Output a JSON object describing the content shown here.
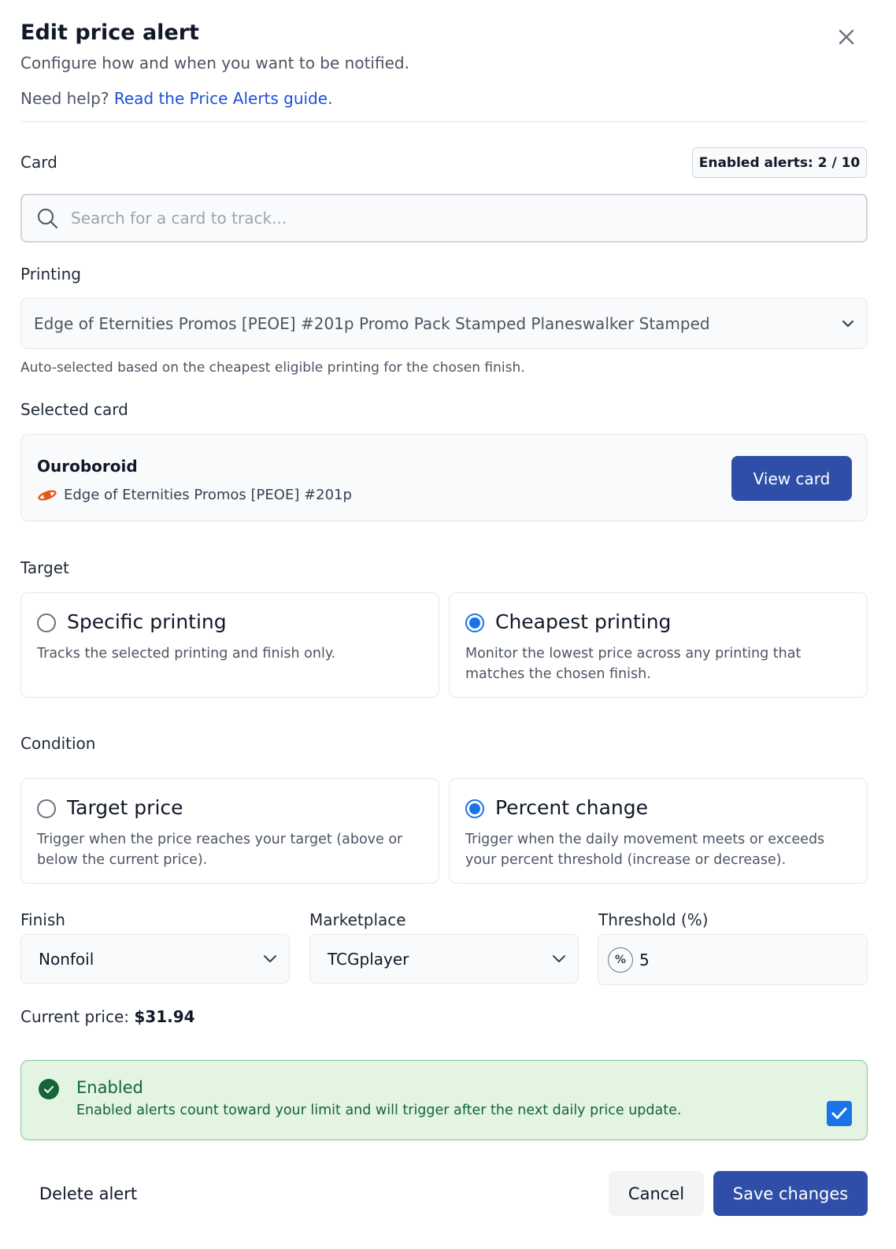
{
  "header": {
    "title": "Edit price alert",
    "subtitle": "Configure how and when you want to be notified.",
    "help_prefix": "Need help?",
    "help_link": "Read the Price Alerts guide",
    "help_suffix": "."
  },
  "card_section": {
    "label": "Card",
    "badge": "Enabled alerts: 2 / 10",
    "search_placeholder": "Search for a card to track..."
  },
  "printing": {
    "label": "Printing",
    "selected": "Edge of Eternities Promos [PEOE] #201p Promo Pack Stamped Planeswalker Stamped",
    "hint": "Auto-selected based on the cheapest eligible printing for the chosen finish."
  },
  "selected_card": {
    "label": "Selected card",
    "name": "Ouroboroid",
    "set": "Edge of Eternities Promos [PEOE] #201p",
    "view_button": "View card"
  },
  "target": {
    "label": "Target",
    "options": [
      {
        "title": "Specific printing",
        "desc": "Tracks the selected printing and finish only.",
        "checked": false
      },
      {
        "title": "Cheapest printing",
        "desc": "Monitor the lowest price across any printing that matches the chosen finish.",
        "checked": true
      }
    ]
  },
  "condition": {
    "label": "Condition",
    "options": [
      {
        "title": "Target price",
        "desc": "Trigger when the price reaches your target (above or below the current price).",
        "checked": false
      },
      {
        "title": "Percent change",
        "desc": "Trigger when the daily movement meets or exceeds your percent threshold (increase or decrease).",
        "checked": true
      }
    ]
  },
  "fields": {
    "finish_label": "Finish",
    "finish_value": "Nonfoil",
    "marketplace_label": "Marketplace",
    "marketplace_value": "TCGplayer",
    "threshold_label": "Threshold (%)",
    "threshold_symbol": "%",
    "threshold_value": "5"
  },
  "price": {
    "label": "Current price:",
    "value": "$31.94"
  },
  "enabled": {
    "title": "Enabled",
    "desc": "Enabled alerts count toward your limit and will trigger after the next daily price update.",
    "checked": true
  },
  "footer": {
    "delete": "Delete alert",
    "cancel": "Cancel",
    "save": "Save changes"
  },
  "colors": {
    "primary": "#2e4ea8",
    "radio_accent": "#1a73e8",
    "success_bg": "#e3f4e3",
    "success_text": "#166534",
    "link": "#1d4ed8",
    "set_symbol": "#e25a1c"
  }
}
